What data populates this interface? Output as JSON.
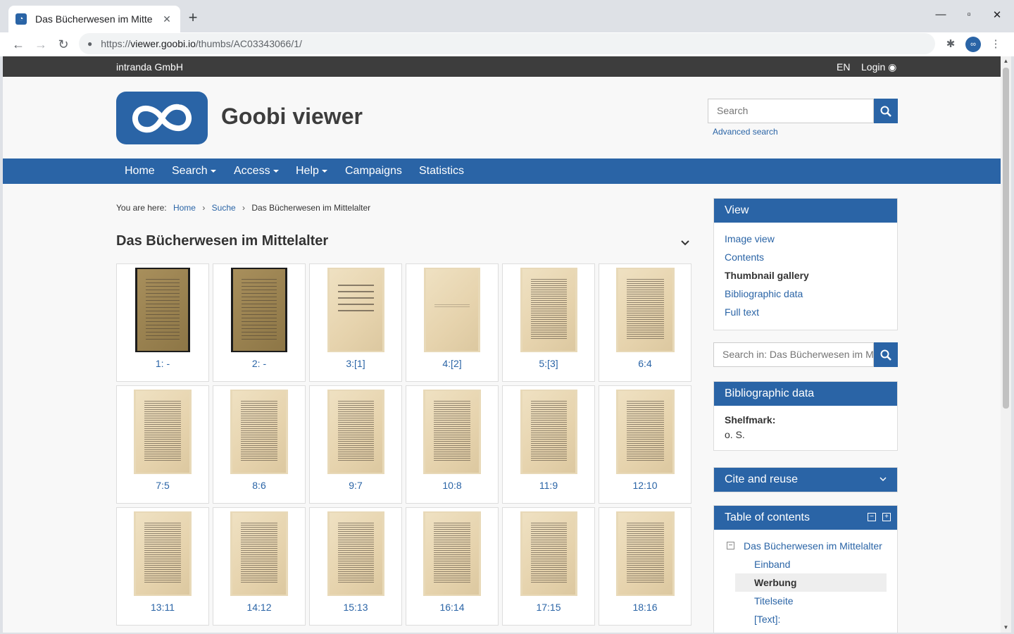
{
  "browser": {
    "tab_title": "Das Bücherwesen im Mitte",
    "url_prefix": "https://",
    "url_host": "viewer.goobi.io",
    "url_path": "/thumbs/AC03343066/1/",
    "profile_initials": "∞"
  },
  "topbar": {
    "company": "intranda GmbH",
    "language": "EN",
    "login": "Login"
  },
  "header": {
    "site_title": "Goobi viewer",
    "search_placeholder": "Search",
    "advanced_search": "Advanced search"
  },
  "nav": {
    "home": "Home",
    "search": "Search",
    "access": "Access",
    "help": "Help",
    "campaigns": "Campaigns",
    "statistics": "Statistics"
  },
  "breadcrumb": {
    "prefix": "You are here:",
    "items": [
      "Home",
      "Suche",
      "Das Bücherwesen im Mittelalter"
    ]
  },
  "page": {
    "title": "Das Bücherwesen im Mittelalter"
  },
  "thumbnails": [
    {
      "label": "1: -"
    },
    {
      "label": "2: -"
    },
    {
      "label": "3:[1]"
    },
    {
      "label": "4:[2]"
    },
    {
      "label": "5:[3]"
    },
    {
      "label": "6:4"
    },
    {
      "label": "7:5"
    },
    {
      "label": "8:6"
    },
    {
      "label": "9:7"
    },
    {
      "label": "10:8"
    },
    {
      "label": "11:9"
    },
    {
      "label": "12:10"
    },
    {
      "label": "13:11"
    },
    {
      "label": "14:12"
    },
    {
      "label": "15:13"
    },
    {
      "label": "16:14"
    },
    {
      "label": "17:15"
    },
    {
      "label": "18:16"
    }
  ],
  "sidebar": {
    "view": {
      "title": "View",
      "links": [
        "Image view",
        "Contents",
        "Thumbnail gallery",
        "Bibliographic data",
        "Full text"
      ],
      "active": "Thumbnail gallery"
    },
    "search_in_placeholder": "Search in: Das Bücherwesen im Mittelalter",
    "biblio": {
      "title": "Bibliographic data",
      "shelfmark_label": "Shelfmark:",
      "shelfmark_value": "o. S."
    },
    "cite": {
      "title": "Cite and reuse"
    },
    "toc": {
      "title": "Table of contents",
      "root": "Das Bücherwesen im Mittelalter",
      "items": [
        "Einband",
        "Werbung",
        "Titelseite",
        "[Text]:"
      ],
      "active": "Werbung"
    }
  },
  "colors": {
    "brand": "#2a64a6",
    "topbar": "#3d3d3d",
    "page_bg": "#f8f8f8"
  }
}
